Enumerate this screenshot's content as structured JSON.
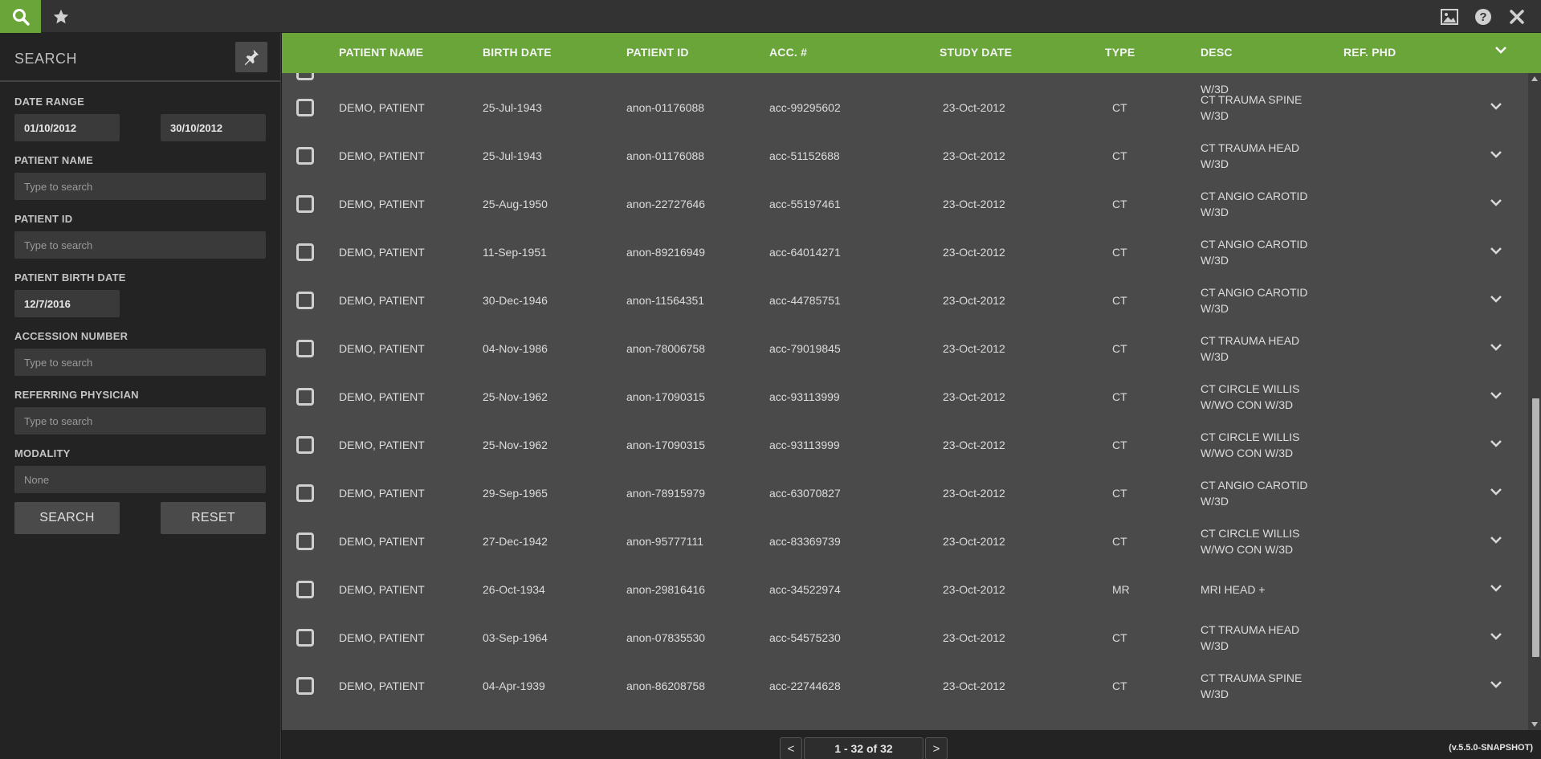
{
  "sidebar": {
    "title": "SEARCH",
    "date_range_label": "DATE RANGE",
    "date_from": "01/10/2012",
    "date_to": "30/10/2012",
    "patient_name_label": "PATIENT NAME",
    "patient_name_placeholder": "Type to search",
    "patient_id_label": "PATIENT ID",
    "patient_id_placeholder": "Type to search",
    "birth_date_label": "PATIENT BIRTH DATE",
    "birth_date_value": "12/7/2016",
    "accession_label": "ACCESSION NUMBER",
    "accession_placeholder": "Type to search",
    "ref_physician_label": "REFERRING PHYSICIAN",
    "ref_physician_placeholder": "Type to search",
    "modality_label": "MODALITY",
    "modality_value": "None",
    "search_button": "SEARCH",
    "reset_button": "RESET"
  },
  "table": {
    "columns": [
      "PATIENT NAME",
      "BIRTH DATE",
      "PATIENT ID",
      "ACC. #",
      "STUDY DATE",
      "TYPE",
      "DESC",
      "REF. PHD"
    ],
    "partial_row_desc": "W/3D",
    "rows": [
      {
        "name": "DEMO, PATIENT",
        "birth": "25-Jul-1943",
        "pid": "anon-01176088",
        "acc": "acc-99295602",
        "study": "23-Oct-2012",
        "type": "CT",
        "desc": "CT TRAUMA SPINE W/3D",
        "ref": ""
      },
      {
        "name": "DEMO, PATIENT",
        "birth": "25-Jul-1943",
        "pid": "anon-01176088",
        "acc": "acc-51152688",
        "study": "23-Oct-2012",
        "type": "CT",
        "desc": "CT TRAUMA HEAD W/3D",
        "ref": ""
      },
      {
        "name": "DEMO, PATIENT",
        "birth": "25-Aug-1950",
        "pid": "anon-22727646",
        "acc": "acc-55197461",
        "study": "23-Oct-2012",
        "type": "CT",
        "desc": "CT ANGIO CAROTID W/3D",
        "ref": ""
      },
      {
        "name": "DEMO, PATIENT",
        "birth": "11-Sep-1951",
        "pid": "anon-89216949",
        "acc": "acc-64014271",
        "study": "23-Oct-2012",
        "type": "CT",
        "desc": "CT ANGIO CAROTID W/3D",
        "ref": ""
      },
      {
        "name": "DEMO, PATIENT",
        "birth": "30-Dec-1946",
        "pid": "anon-11564351",
        "acc": "acc-44785751",
        "study": "23-Oct-2012",
        "type": "CT",
        "desc": "CT ANGIO CAROTID W/3D",
        "ref": ""
      },
      {
        "name": "DEMO, PATIENT",
        "birth": "04-Nov-1986",
        "pid": "anon-78006758",
        "acc": "acc-79019845",
        "study": "23-Oct-2012",
        "type": "CT",
        "desc": "CT TRAUMA HEAD W/3D",
        "ref": ""
      },
      {
        "name": "DEMO, PATIENT",
        "birth": "25-Nov-1962",
        "pid": "anon-17090315",
        "acc": "acc-93113999",
        "study": "23-Oct-2012",
        "type": "CT",
        "desc": "CT CIRCLE WILLIS W/WO CON W/3D",
        "ref": ""
      },
      {
        "name": "DEMO, PATIENT",
        "birth": "25-Nov-1962",
        "pid": "anon-17090315",
        "acc": "acc-93113999",
        "study": "23-Oct-2012",
        "type": "CT",
        "desc": "CT CIRCLE WILLIS W/WO CON W/3D",
        "ref": ""
      },
      {
        "name": "DEMO, PATIENT",
        "birth": "29-Sep-1965",
        "pid": "anon-78915979",
        "acc": "acc-63070827",
        "study": "23-Oct-2012",
        "type": "CT",
        "desc": "CT ANGIO CAROTID W/3D",
        "ref": ""
      },
      {
        "name": "DEMO, PATIENT",
        "birth": "27-Dec-1942",
        "pid": "anon-95777111",
        "acc": "acc-83369739",
        "study": "23-Oct-2012",
        "type": "CT",
        "desc": "CT CIRCLE WILLIS W/WO CON W/3D",
        "ref": ""
      },
      {
        "name": "DEMO, PATIENT",
        "birth": "26-Oct-1934",
        "pid": "anon-29816416",
        "acc": "acc-34522974",
        "study": "23-Oct-2012",
        "type": "MR",
        "desc": "MRI HEAD +",
        "ref": ""
      },
      {
        "name": "DEMO, PATIENT",
        "birth": "03-Sep-1964",
        "pid": "anon-07835530",
        "acc": "acc-54575230",
        "study": "23-Oct-2012",
        "type": "CT",
        "desc": "CT TRAUMA HEAD W/3D",
        "ref": ""
      },
      {
        "name": "DEMO, PATIENT",
        "birth": "04-Apr-1939",
        "pid": "anon-86208758",
        "acc": "acc-22744628",
        "study": "23-Oct-2012",
        "type": "CT",
        "desc": "CT TRAUMA SPINE W/3D",
        "ref": ""
      }
    ]
  },
  "pagination": {
    "prev": "<",
    "next": ">",
    "label": "1 - 32 of 32"
  },
  "version": "(v.5.5.0-SNAPSHOT)",
  "colors": {
    "accent": "#6aa53a",
    "panel": "#232323",
    "table_bg": "#4a4a4a"
  },
  "icons": [
    "search-icon",
    "star-icon",
    "image-icon",
    "help-icon",
    "close-icon",
    "pin-icon",
    "chevron-down-icon"
  ]
}
